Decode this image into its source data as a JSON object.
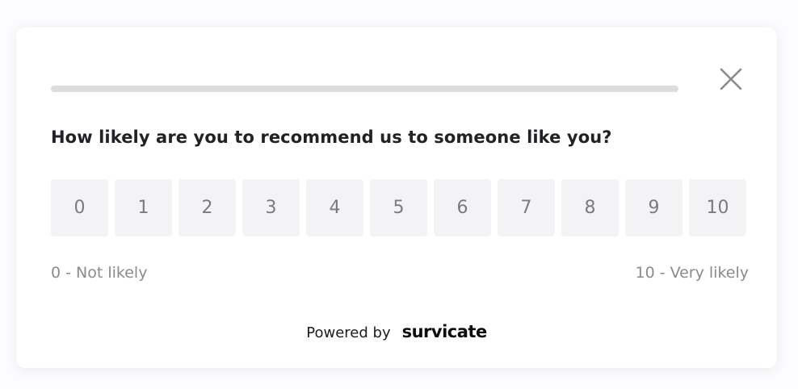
{
  "survey": {
    "progress": 0,
    "question": "How likely are you to recommend us to someone like you?",
    "scale": [
      "0",
      "1",
      "2",
      "3",
      "4",
      "5",
      "6",
      "7",
      "8",
      "9",
      "10"
    ],
    "low_label": "0 - Not likely",
    "high_label": "10 - Very likely",
    "close_icon": "close-icon"
  },
  "footer": {
    "powered_by": "Powered by",
    "brand": "survicate"
  },
  "colors": {
    "card_background": "#ffffff",
    "scale_button_background": "#f3f2f4",
    "progress_track": "#dcdcde",
    "text_primary": "#222226",
    "text_muted": "#8a8a8f"
  }
}
